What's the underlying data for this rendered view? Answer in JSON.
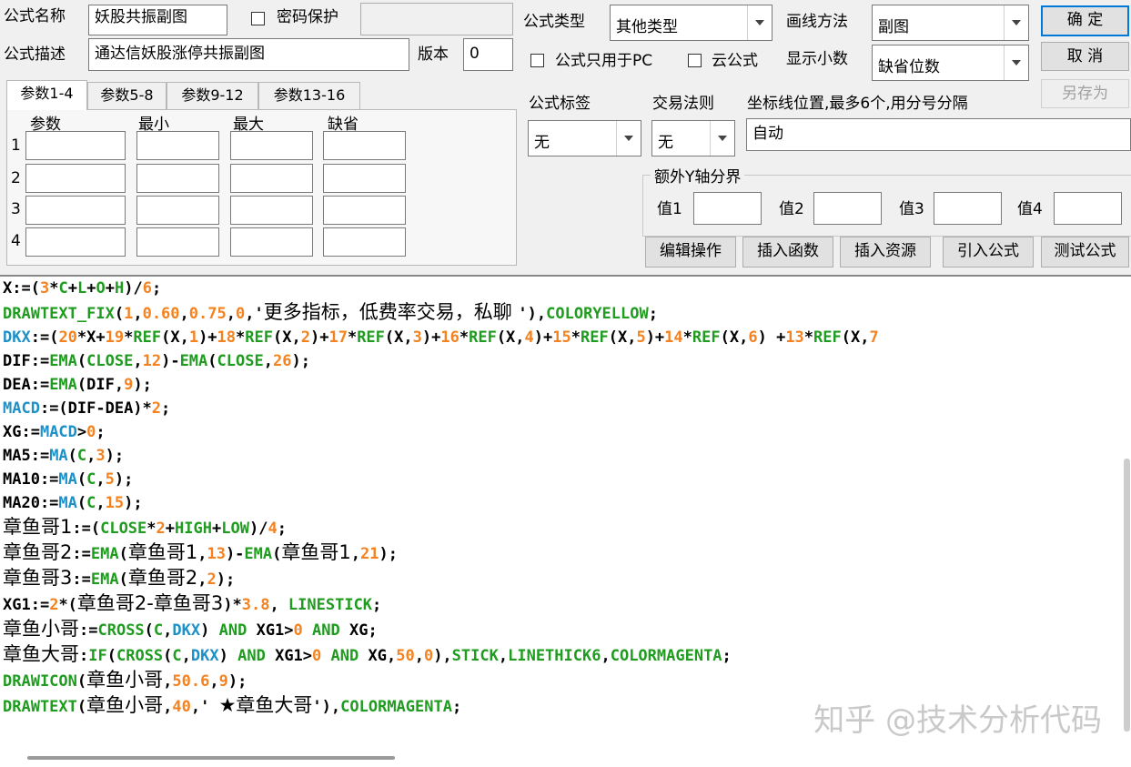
{
  "header": {
    "name_label": "公式名称",
    "name_value": "妖股共振副图",
    "password_label": "密码保护",
    "password_checked": false,
    "password_value": "",
    "desc_label": "公式描述",
    "desc_value": "通达信妖股涨停共振副图",
    "version_label": "版本",
    "version_value": "0",
    "type_label": "公式类型",
    "type_value": "其他类型",
    "draw_label": "画线方法",
    "draw_value": "副图",
    "pc_only_label": "公式只用于PC",
    "pc_only_checked": false,
    "cloud_label": "云公式",
    "cloud_checked": false,
    "decimals_label": "显示小数",
    "decimals_value": "缺省位数"
  },
  "buttons": {
    "ok": "确 定",
    "cancel": "取 消",
    "save_as": "另存为",
    "edit_ops": "编辑操作",
    "insert_func": "插入函数",
    "insert_res": "插入资源",
    "import_formula": "引入公式",
    "test_formula": "测试公式"
  },
  "tabs": [
    "参数1-4",
    "参数5-8",
    "参数9-12",
    "参数13-16"
  ],
  "params": {
    "columns": [
      "参数",
      "最小",
      "最大",
      "缺省"
    ],
    "rows": [
      "1",
      "2",
      "3",
      "4"
    ]
  },
  "options": {
    "tag_label": "公式标签",
    "tag_value": "无",
    "rule_label": "交易法则",
    "rule_value": "无",
    "coord_label": "坐标线位置,最多6个,用分号分隔",
    "coord_value": "自动",
    "yaxis_legend": "额外Y轴分界",
    "y_labels": [
      "值1",
      "值2",
      "值3",
      "值4"
    ]
  },
  "code_lines": [
    [
      [
        "k-plain",
        "X:=("
      ],
      [
        "k-orange",
        "3"
      ],
      [
        "k-plain",
        "*"
      ],
      [
        "k-green",
        "C"
      ],
      [
        "k-plain",
        "+"
      ],
      [
        "k-green",
        "L"
      ],
      [
        "k-plain",
        "+"
      ],
      [
        "k-green",
        "O"
      ],
      [
        "k-plain",
        "+"
      ],
      [
        "k-green",
        "H"
      ],
      [
        "k-plain",
        ")/"
      ],
      [
        "k-orange",
        "6"
      ],
      [
        "k-plain",
        ";"
      ]
    ],
    [
      [
        "k-green",
        "DRAWTEXT_FIX"
      ],
      [
        "k-plain",
        "("
      ],
      [
        "k-orange",
        "1"
      ],
      [
        "k-plain",
        ","
      ],
      [
        "k-orange",
        "0.60"
      ],
      [
        "k-plain",
        ","
      ],
      [
        "k-orange",
        "0.75"
      ],
      [
        "k-plain",
        ","
      ],
      [
        "k-orange",
        "0"
      ],
      [
        "k-plain",
        ",'"
      ],
      [
        "cjk",
        "更多指标，低费率交易，私聊 "
      ],
      [
        "k-plain",
        "'),"
      ],
      [
        "k-green",
        "COLORYELLOW"
      ],
      [
        "k-plain",
        ";"
      ]
    ],
    [
      [
        "k-blue",
        "DKX"
      ],
      [
        "k-plain",
        ":=("
      ],
      [
        "k-orange",
        "20"
      ],
      [
        "k-plain",
        "*X+"
      ],
      [
        "k-orange",
        "19"
      ],
      [
        "k-plain",
        "*"
      ],
      [
        "k-green",
        "REF"
      ],
      [
        "k-plain",
        "(X,"
      ],
      [
        "k-orange",
        "1"
      ],
      [
        "k-plain",
        ")+"
      ],
      [
        "k-orange",
        "18"
      ],
      [
        "k-plain",
        "*"
      ],
      [
        "k-green",
        "REF"
      ],
      [
        "k-plain",
        "(X,"
      ],
      [
        "k-orange",
        "2"
      ],
      [
        "k-plain",
        ")+"
      ],
      [
        "k-orange",
        "17"
      ],
      [
        "k-plain",
        "*"
      ],
      [
        "k-green",
        "REF"
      ],
      [
        "k-plain",
        "(X,"
      ],
      [
        "k-orange",
        "3"
      ],
      [
        "k-plain",
        ")+"
      ],
      [
        "k-orange",
        "16"
      ],
      [
        "k-plain",
        "*"
      ],
      [
        "k-green",
        "REF"
      ],
      [
        "k-plain",
        "(X,"
      ],
      [
        "k-orange",
        "4"
      ],
      [
        "k-plain",
        ")+"
      ],
      [
        "k-orange",
        "15"
      ],
      [
        "k-plain",
        "*"
      ],
      [
        "k-green",
        "REF"
      ],
      [
        "k-plain",
        "(X,"
      ],
      [
        "k-orange",
        "5"
      ],
      [
        "k-plain",
        ")+"
      ],
      [
        "k-orange",
        "14"
      ],
      [
        "k-plain",
        "*"
      ],
      [
        "k-green",
        "REF"
      ],
      [
        "k-plain",
        "(X,"
      ],
      [
        "k-orange",
        "6"
      ],
      [
        "k-plain",
        ") +"
      ],
      [
        "k-orange",
        "13"
      ],
      [
        "k-plain",
        "*"
      ],
      [
        "k-green",
        "REF"
      ],
      [
        "k-plain",
        "(X,"
      ],
      [
        "k-orange",
        "7"
      ]
    ],
    [
      [
        "k-plain",
        "DIF:="
      ],
      [
        "k-green",
        "EMA"
      ],
      [
        "k-plain",
        "("
      ],
      [
        "k-green",
        "CLOSE"
      ],
      [
        "k-plain",
        ","
      ],
      [
        "k-orange",
        "12"
      ],
      [
        "k-plain",
        ")-"
      ],
      [
        "k-green",
        "EMA"
      ],
      [
        "k-plain",
        "("
      ],
      [
        "k-green",
        "CLOSE"
      ],
      [
        "k-plain",
        ","
      ],
      [
        "k-orange",
        "26"
      ],
      [
        "k-plain",
        ");"
      ]
    ],
    [
      [
        "k-plain",
        "DEA:="
      ],
      [
        "k-green",
        "EMA"
      ],
      [
        "k-plain",
        "(DIF,"
      ],
      [
        "k-orange",
        "9"
      ],
      [
        "k-plain",
        ");"
      ]
    ],
    [
      [
        "k-blue",
        "MACD"
      ],
      [
        "k-plain",
        ":=(DIF-DEA)*"
      ],
      [
        "k-orange",
        "2"
      ],
      [
        "k-plain",
        ";"
      ]
    ],
    [
      [
        "k-plain",
        "XG:="
      ],
      [
        "k-blue",
        "MACD"
      ],
      [
        "k-plain",
        ">"
      ],
      [
        "k-orange",
        "0"
      ],
      [
        "k-plain",
        ";"
      ]
    ],
    [
      [
        "k-plain",
        "MA5:="
      ],
      [
        "k-blue",
        "MA"
      ],
      [
        "k-plain",
        "("
      ],
      [
        "k-green",
        "C"
      ],
      [
        "k-plain",
        ","
      ],
      [
        "k-orange",
        "3"
      ],
      [
        "k-plain",
        ");"
      ]
    ],
    [
      [
        "k-plain",
        "MA10:="
      ],
      [
        "k-blue",
        "MA"
      ],
      [
        "k-plain",
        "("
      ],
      [
        "k-green",
        "C"
      ],
      [
        "k-plain",
        ","
      ],
      [
        "k-orange",
        "5"
      ],
      [
        "k-plain",
        ");"
      ]
    ],
    [
      [
        "k-plain",
        "MA20:="
      ],
      [
        "k-blue",
        "MA"
      ],
      [
        "k-plain",
        "("
      ],
      [
        "k-green",
        "C"
      ],
      [
        "k-plain",
        ","
      ],
      [
        "k-orange",
        "15"
      ],
      [
        "k-plain",
        ");"
      ]
    ],
    [
      [
        "cjk",
        "章鱼哥1"
      ],
      [
        "k-plain",
        ":=("
      ],
      [
        "k-green",
        "CLOSE"
      ],
      [
        "k-plain",
        "*"
      ],
      [
        "k-orange",
        "2"
      ],
      [
        "k-plain",
        "+"
      ],
      [
        "k-green",
        "HIGH"
      ],
      [
        "k-plain",
        "+"
      ],
      [
        "k-green",
        "LOW"
      ],
      [
        "k-plain",
        ")/"
      ],
      [
        "k-orange",
        "4"
      ],
      [
        "k-plain",
        ";"
      ]
    ],
    [
      [
        "cjk",
        "章鱼哥2"
      ],
      [
        "k-plain",
        ":="
      ],
      [
        "k-green",
        "EMA"
      ],
      [
        "k-plain",
        "("
      ],
      [
        "cjk",
        "章鱼哥1"
      ],
      [
        "k-plain",
        ","
      ],
      [
        "k-orange",
        "13"
      ],
      [
        "k-plain",
        ")-"
      ],
      [
        "k-green",
        "EMA"
      ],
      [
        "k-plain",
        "("
      ],
      [
        "cjk",
        "章鱼哥1"
      ],
      [
        "k-plain",
        ","
      ],
      [
        "k-orange",
        "21"
      ],
      [
        "k-plain",
        ");"
      ]
    ],
    [
      [
        "cjk",
        "章鱼哥3"
      ],
      [
        "k-plain",
        ":="
      ],
      [
        "k-green",
        "EMA"
      ],
      [
        "k-plain",
        "("
      ],
      [
        "cjk",
        "章鱼哥2"
      ],
      [
        "k-plain",
        ","
      ],
      [
        "k-orange",
        "2"
      ],
      [
        "k-plain",
        ");"
      ]
    ],
    [
      [
        "k-plain",
        "XG1:="
      ],
      [
        "k-orange",
        "2"
      ],
      [
        "k-plain",
        "*("
      ],
      [
        "cjk",
        "章鱼哥2-章鱼哥3"
      ],
      [
        "k-plain",
        ")*"
      ],
      [
        "k-orange",
        "3.8"
      ],
      [
        "k-plain",
        ", "
      ],
      [
        "k-green",
        "LINESTICK"
      ],
      [
        "k-plain",
        ";"
      ]
    ],
    [
      [
        "cjk",
        "章鱼小哥"
      ],
      [
        "k-plain",
        ":="
      ],
      [
        "k-green",
        "CROSS"
      ],
      [
        "k-plain",
        "("
      ],
      [
        "k-green",
        "C"
      ],
      [
        "k-plain",
        ","
      ],
      [
        "k-blue",
        "DKX"
      ],
      [
        "k-plain",
        ") "
      ],
      [
        "k-green",
        "AND"
      ],
      [
        "k-plain",
        " XG1>"
      ],
      [
        "k-orange",
        "0"
      ],
      [
        "k-plain",
        " "
      ],
      [
        "k-green",
        "AND"
      ],
      [
        "k-plain",
        " XG;"
      ]
    ],
    [
      [
        "cjk",
        "章鱼大哥"
      ],
      [
        "k-plain",
        ":"
      ],
      [
        "k-green",
        "IF"
      ],
      [
        "k-plain",
        "("
      ],
      [
        "k-green",
        "CROSS"
      ],
      [
        "k-plain",
        "("
      ],
      [
        "k-green",
        "C"
      ],
      [
        "k-plain",
        ","
      ],
      [
        "k-blue",
        "DKX"
      ],
      [
        "k-plain",
        ") "
      ],
      [
        "k-green",
        "AND"
      ],
      [
        "k-plain",
        " XG1>"
      ],
      [
        "k-orange",
        "0"
      ],
      [
        "k-plain",
        " "
      ],
      [
        "k-green",
        "AND"
      ],
      [
        "k-plain",
        " XG,"
      ],
      [
        "k-orange",
        "50"
      ],
      [
        "k-plain",
        ","
      ],
      [
        "k-orange",
        "0"
      ],
      [
        "k-plain",
        "),"
      ],
      [
        "k-green",
        "STICK"
      ],
      [
        "k-plain",
        ","
      ],
      [
        "k-green",
        "LINETHICK6"
      ],
      [
        "k-plain",
        ","
      ],
      [
        "k-green",
        "COLORMAGENTA"
      ],
      [
        "k-plain",
        ";"
      ]
    ],
    [
      [
        "k-green",
        "DRAWICON"
      ],
      [
        "k-plain",
        "("
      ],
      [
        "cjk",
        "章鱼小哥"
      ],
      [
        "k-plain",
        ","
      ],
      [
        "k-orange",
        "50.6"
      ],
      [
        "k-plain",
        ","
      ],
      [
        "k-orange",
        "9"
      ],
      [
        "k-plain",
        ");"
      ]
    ],
    [
      [
        "k-green",
        "DRAWTEXT"
      ],
      [
        "k-plain",
        "("
      ],
      [
        "cjk",
        "章鱼小哥"
      ],
      [
        "k-plain",
        ","
      ],
      [
        "k-orange",
        "40"
      ],
      [
        "k-plain",
        ",' "
      ],
      [
        "cjk",
        "★章鱼大哥"
      ],
      [
        "k-plain",
        "'),"
      ],
      [
        "k-green",
        "COLORMAGENTA"
      ],
      [
        "k-plain",
        ";"
      ]
    ]
  ],
  "watermark": "知乎 @技术分析代码"
}
